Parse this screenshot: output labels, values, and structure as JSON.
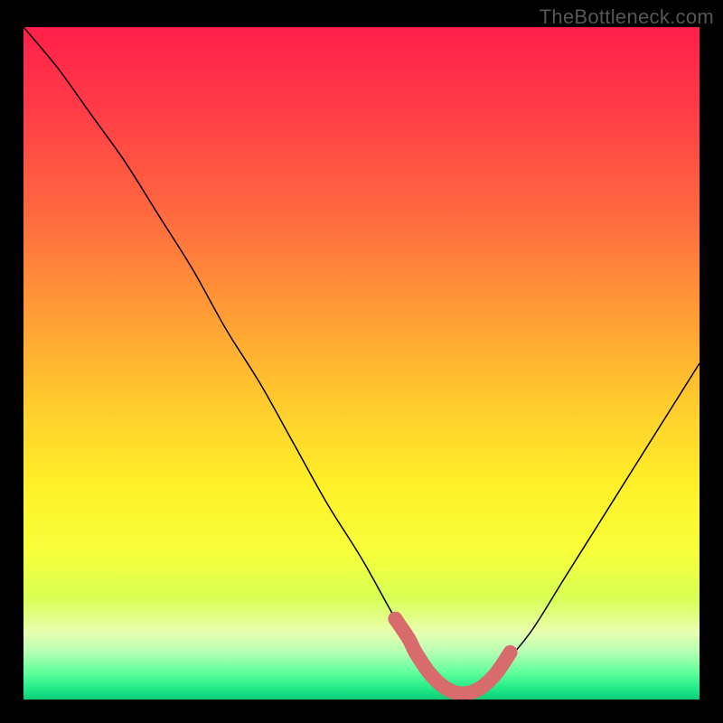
{
  "watermark": "TheBottleneck.com",
  "chart_data": {
    "type": "line",
    "title": "",
    "xlabel": "",
    "ylabel": "",
    "xlim": [
      0,
      100
    ],
    "ylim": [
      0,
      100
    ],
    "grid": false,
    "series": [
      {
        "name": "bottleneck-curve",
        "x": [
          0,
          5,
          10,
          15,
          20,
          25,
          30,
          35,
          40,
          45,
          50,
          55,
          58,
          60,
          62,
          64,
          66,
          68,
          70,
          75,
          80,
          85,
          90,
          95,
          100
        ],
        "y": [
          100,
          94,
          87,
          80,
          72,
          64,
          55,
          47,
          38,
          29,
          21,
          12,
          7,
          4,
          2,
          1,
          1,
          2,
          4,
          10,
          18,
          26,
          34,
          42,
          50
        ],
        "stroke": "#000000",
        "width": 1.5
      }
    ],
    "highlight": {
      "name": "optimal-range",
      "color": "#d86b6b",
      "dot_radius": 8,
      "x": [
        55,
        57,
        58,
        60,
        62,
        64,
        66,
        68,
        70,
        72
      ],
      "y": [
        12,
        9,
        7,
        4,
        2,
        1,
        1,
        2,
        4,
        7
      ]
    },
    "background_gradient": {
      "stops": [
        {
          "offset": 0.0,
          "color": "#ff1f4b"
        },
        {
          "offset": 0.12,
          "color": "#ff3b47"
        },
        {
          "offset": 0.28,
          "color": "#ff6a3f"
        },
        {
          "offset": 0.42,
          "color": "#ff9a36"
        },
        {
          "offset": 0.55,
          "color": "#ffc82e"
        },
        {
          "offset": 0.68,
          "color": "#fff028"
        },
        {
          "offset": 0.78,
          "color": "#f7ff3a"
        },
        {
          "offset": 0.85,
          "color": "#d8ff55"
        },
        {
          "offset": 0.9,
          "color": "#e8ffb0"
        },
        {
          "offset": 0.93,
          "color": "#b4ffb4"
        },
        {
          "offset": 0.96,
          "color": "#5fff9c"
        },
        {
          "offset": 0.985,
          "color": "#1fe887"
        },
        {
          "offset": 1.0,
          "color": "#0fcb76"
        }
      ]
    }
  }
}
